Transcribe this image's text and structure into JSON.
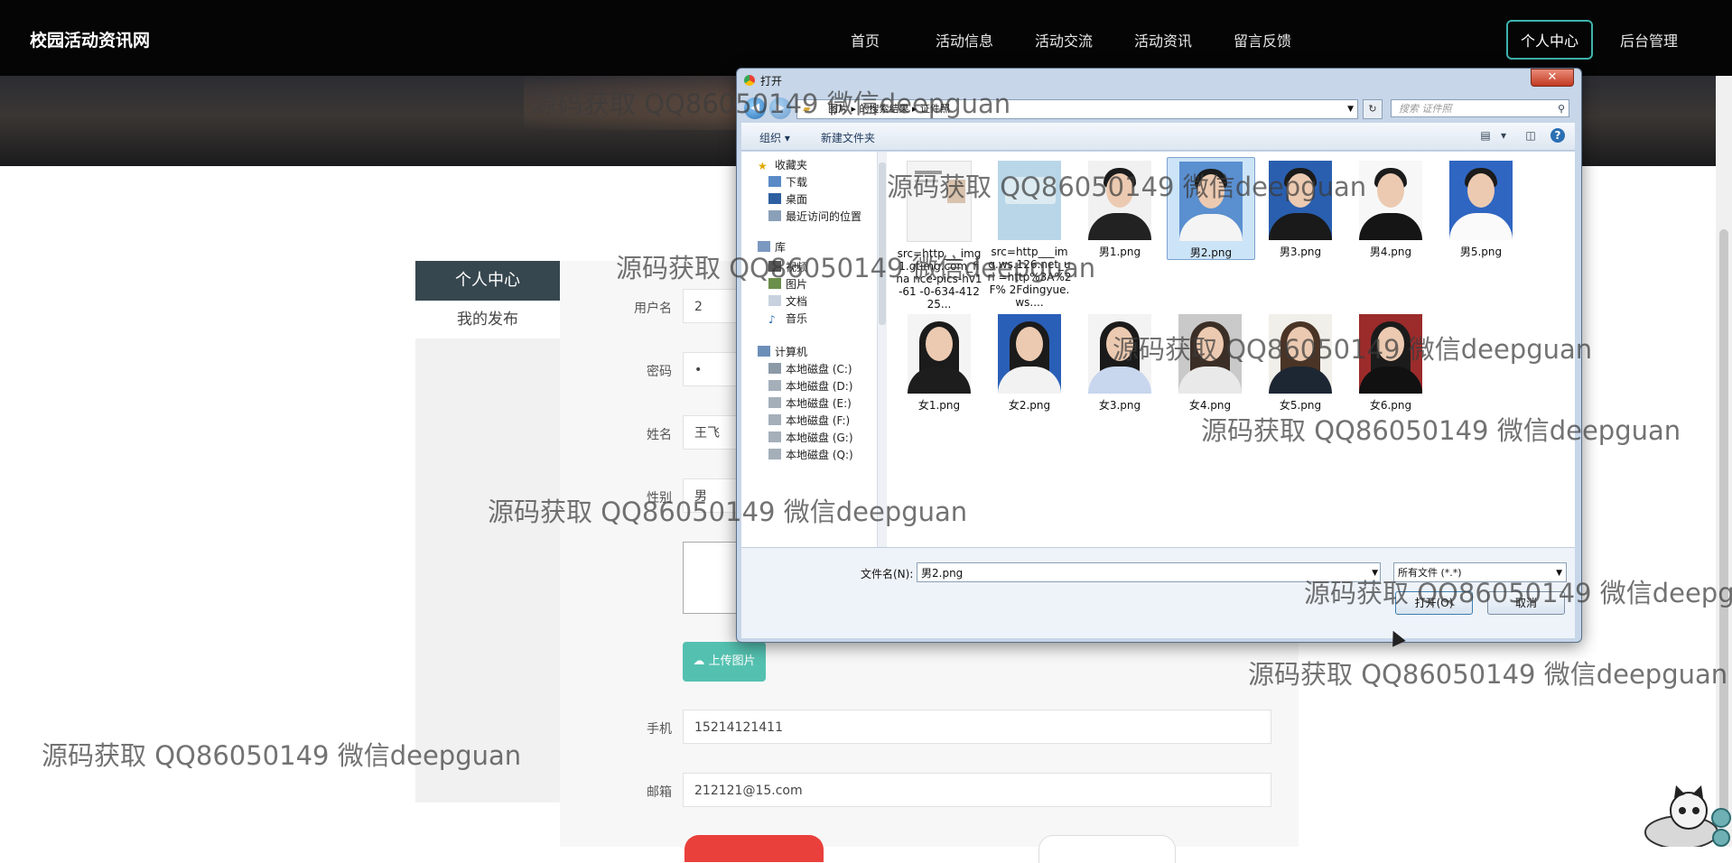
{
  "site": {
    "brand": "校园活动资讯网",
    "nav": [
      "首页",
      "活动信息",
      "活动交流",
      "活动资讯",
      "留言反馈",
      "个人中心",
      "后台管理"
    ],
    "active_nav": "个人中心"
  },
  "sidebar": {
    "title": "个人中心",
    "items": [
      "我的发布"
    ]
  },
  "form": {
    "username_label": "用户名",
    "username_value": "2",
    "password_label": "密码",
    "password_value": "•",
    "name_label": "姓名",
    "name_value": "王飞",
    "gender_label": "性别",
    "gender_value": "男",
    "upload_label": "上传图片",
    "phone_label": "手机",
    "phone_value": "15214121411",
    "email_label": "邮箱",
    "email_value": "212121@15.com"
  },
  "dialog": {
    "title": "打开",
    "close": "✕",
    "address": "图片 ▸ 的搜索结果 ▸ 证件照",
    "address_parts": [
      "图片",
      "的搜索结果",
      "证件照"
    ],
    "search_placeholder": "搜索 证件照",
    "toolbar": {
      "organize": "组织 ▾",
      "new_folder": "新建文件夹"
    },
    "tree": {
      "favorites": "收藏夹",
      "fav_items": [
        "下载",
        "桌面",
        "最近访问的位置"
      ],
      "library": "库",
      "lib_items": [
        "视频",
        "图片",
        "文档",
        "音乐"
      ],
      "computer": "计算机",
      "drives": [
        "本地磁盘 (C:)",
        "本地磁盘 (D:)",
        "本地磁盘 (E:)",
        "本地磁盘 (F:)",
        "本地磁盘 (G:)",
        "本地磁盘 (Q:)"
      ]
    },
    "files": [
      {
        "name": "src=http___img1.gtimg.com_fina nce-pics-hv1-61 -0-634-41225...",
        "kind": "doc"
      },
      {
        "name": "src=http___img.ws.126.net_url =http%3A%2F% 2Fdingyue.ws....",
        "kind": "idcard"
      },
      {
        "name": "男1.png",
        "kind": "male"
      },
      {
        "name": "男2.png",
        "kind": "male",
        "selected": true
      },
      {
        "name": "男3.png",
        "kind": "male"
      },
      {
        "name": "男4.png",
        "kind": "male"
      },
      {
        "name": "男5.png",
        "kind": "male"
      },
      {
        "name": "女1.png",
        "kind": "female"
      },
      {
        "name": "女2.png",
        "kind": "female"
      },
      {
        "name": "女3.png",
        "kind": "female"
      },
      {
        "name": "女4.png",
        "kind": "female"
      },
      {
        "name": "女5.png",
        "kind": "female"
      },
      {
        "name": "女6.png",
        "kind": "female"
      }
    ],
    "filename_label": "文件名(N):",
    "filename_value": "男2.png",
    "filetype_value": "所有文件 (*.*)",
    "open_button": "打开(O)",
    "cancel_button": "取消"
  },
  "watermark": "源码获取 QQ86050149 微信deepguan",
  "watermark_clipped": "源码获取 QQ86050149 微信deepg"
}
